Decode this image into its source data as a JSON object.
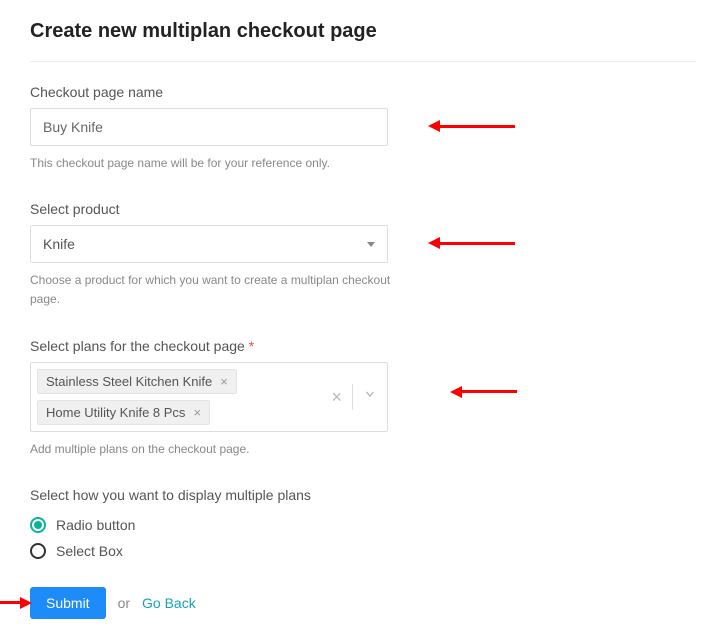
{
  "page_title": "Create new multiplan checkout page",
  "fields": {
    "name": {
      "label": "Checkout page name",
      "value": "Buy Knife",
      "help": "This checkout page name will be for your reference only."
    },
    "product": {
      "label": "Select product",
      "value": "Knife",
      "help": "Choose a product for which you want to create a multiplan checkout page."
    },
    "plans": {
      "label": "Select plans for the checkout page",
      "required_mark": "*",
      "chips": [
        "Stainless Steel Kitchen Knife",
        "Home Utility Knife 8 Pcs"
      ],
      "help": "Add multiple plans on the checkout page."
    },
    "display": {
      "label": "Select how you want to display multiple plans",
      "options": [
        "Radio button",
        "Select Box"
      ],
      "selected": "Radio button"
    }
  },
  "actions": {
    "submit": "Submit",
    "or": "or",
    "goback": "Go Back"
  },
  "icons": {
    "chip_remove": "×",
    "clear_all": "×"
  }
}
